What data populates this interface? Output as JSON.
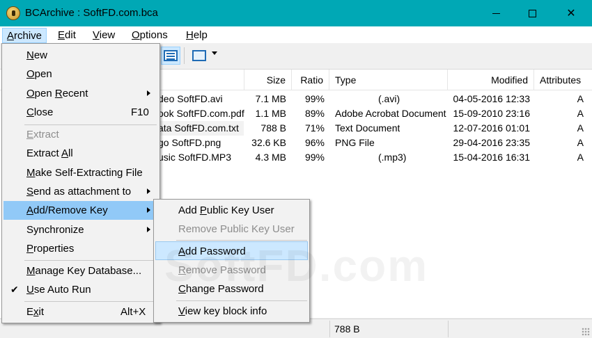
{
  "window": {
    "title": "BCArchive : SoftFD.com.bca"
  },
  "menubar": [
    {
      "label": "Archive",
      "key": "A",
      "rest": "rchive"
    },
    {
      "label": "Edit",
      "key": "E",
      "rest": "dit"
    },
    {
      "label": "View",
      "key": "V",
      "rest": "iew"
    },
    {
      "label": "Options",
      "key": "O",
      "rest": "ptions"
    },
    {
      "label": "Help",
      "key": "H",
      "rest": "elp"
    }
  ],
  "columns": {
    "size": "Size",
    "ratio": "Ratio",
    "type": "Type",
    "modified": "Modified",
    "attributes": "Attributes"
  },
  "files": [
    {
      "name": "deo SoftFD.avi",
      "size": "7.1 MB",
      "ratio": "99%",
      "type": "(.avi)",
      "modified": "04-05-2016 12:33",
      "attr": "A"
    },
    {
      "name": "ook SoftFD.com.pdf",
      "size": "1.1 MB",
      "ratio": "89%",
      "type": "Adobe Acrobat Document",
      "modified": "15-09-2010 23:16",
      "attr": "A"
    },
    {
      "name": "ata SoftFD.com.txt",
      "size": "788 B",
      "ratio": "71%",
      "type": "Text Document",
      "modified": "12-07-2016 01:01",
      "attr": "A"
    },
    {
      "name": "go SoftFD.png",
      "size": "32.6 KB",
      "ratio": "96%",
      "type": "PNG File",
      "modified": "29-04-2016 23:35",
      "attr": "A"
    },
    {
      "name": "usic SoftFD.MP3",
      "size": "4.3 MB",
      "ratio": "99%",
      "type": "(.mp3)",
      "modified": "15-04-2016 16:31",
      "attr": "A"
    }
  ],
  "status": {
    "selected_size": "788 B"
  },
  "archive_menu": {
    "new": {
      "k": "N",
      "r": "ew"
    },
    "open": {
      "k": "O",
      "r": "pen"
    },
    "open_recent": {
      "k": "O",
      "r": "pen ",
      "k2": "R",
      "r2": "ecent"
    },
    "close": {
      "k": "C",
      "r": "lose",
      "shortcut": "F10"
    },
    "extract": {
      "k": "E",
      "r": "xtract"
    },
    "extract_all": {
      "a": "E",
      "b": "xtract ",
      "k": "A",
      "r": "ll"
    },
    "make_sfx": {
      "k": "M",
      "r": "ake Self-Extracting File"
    },
    "send": {
      "k": "S",
      "r": "end as attachment to"
    },
    "add_remove_key": {
      "k": "A",
      "r": "dd/Remove Key"
    },
    "synchronize": {
      "a": "S",
      "b": "ynchronize"
    },
    "properties": {
      "k": "P",
      "r": "roperties"
    },
    "manage_key_db": {
      "k": "M",
      "r": "anage Key Database..."
    },
    "use_auto_run": {
      "k": "U",
      "r": "se Auto Run",
      "checked": "✔"
    },
    "exit": {
      "a": "E",
      "k": "x",
      "r": "it",
      "shortcut": "Alt+X"
    }
  },
  "key_submenu": {
    "add_public_key_user": {
      "a": "Add ",
      "k": "P",
      "r": "ublic Key User"
    },
    "remove_public_key_user": {
      "a": "Remove Public Key User"
    },
    "add_password": {
      "k": "A",
      "r": "dd Password"
    },
    "remove_password": {
      "k": "R",
      "r": "emove Password"
    },
    "change_password": {
      "k": "C",
      "r": "hange Password"
    },
    "view_key_block_info": {
      "k": "V",
      "r": "iew key block info"
    }
  },
  "watermark": "SoftFD.com",
  "colors": {
    "titlebar": "#00a8b5",
    "highlight": "#91c9f7",
    "selected_item": "#cce8ff"
  },
  "icons": [
    "app-lock-icon",
    "details-view-icon",
    "list-view-icon",
    "chevron-down-icon",
    "chevron-right-icon",
    "checkmark-icon"
  ]
}
